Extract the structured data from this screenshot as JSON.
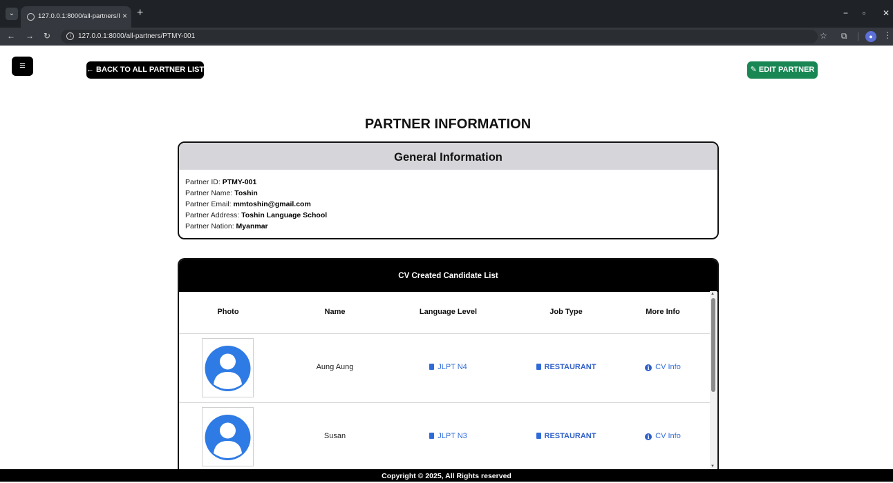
{
  "browser": {
    "tab_title": "127.0.0.1:8000/all-partners/PTM",
    "url": "127.0.0.1:8000/all-partners/PTMY-001",
    "new_tab": "+",
    "tab_close": "×"
  },
  "header": {
    "menu_icon": "≡",
    "back_label": "← BACK TO ALL PARTNER LIST",
    "edit_label": "EDIT PARTNER"
  },
  "page_title": "PARTNER INFORMATION",
  "general": {
    "title": "General Information",
    "fields": [
      {
        "label": "Partner ID: ",
        "value": "PTMY-001"
      },
      {
        "label": "Partner Name: ",
        "value": "Toshin"
      },
      {
        "label": "Partner Email: ",
        "value": "mmtoshin@gmail.com"
      },
      {
        "label": "Partner Address: ",
        "value": "Toshin Language School"
      },
      {
        "label": "Partner Nation: ",
        "value": "Myanmar"
      }
    ]
  },
  "cv_list": {
    "title": "CV Created Candidate List",
    "columns": [
      "Photo",
      "Name",
      "Language Level",
      "Job Type",
      "More Info"
    ],
    "rows": [
      {
        "name": "Aung Aung",
        "language_level": "JLPT N4",
        "job_type": "RESTAURANT",
        "more_info": "CV Info"
      },
      {
        "name": "Susan",
        "language_level": "JLPT N3",
        "job_type": "RESTAURANT",
        "more_info": "CV Info"
      }
    ]
  },
  "footer": {
    "text": "Copyright © 2025, All Rights reserved"
  },
  "colors": {
    "edit_button": "#198754",
    "link": "#2f6bd8",
    "avatar": "#2f7be5"
  }
}
